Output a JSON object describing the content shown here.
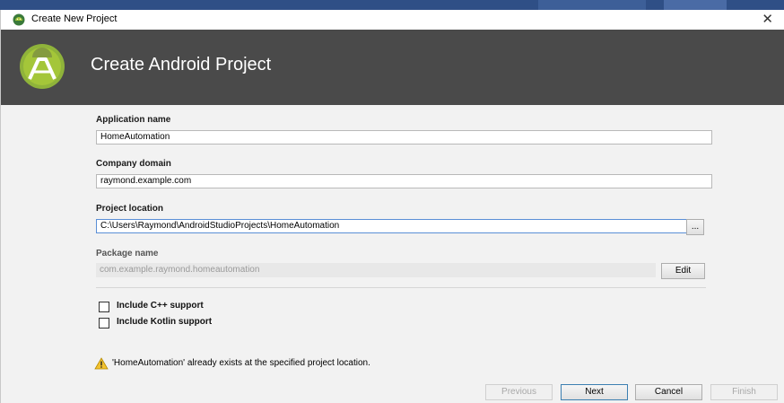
{
  "window": {
    "title": "Create New Project",
    "close_glyph": "✕"
  },
  "banner": {
    "title": "Create Android Project",
    "logo_icon": "android-studio-logo-icon"
  },
  "form": {
    "app_name_label": "Application name",
    "app_name_value": "HomeAutomation",
    "company_domain_label": "Company domain",
    "company_domain_value": "raymond.example.com",
    "project_location_label": "Project location",
    "project_location_value": "C:\\Users\\Raymond\\AndroidStudioProjects\\HomeAutomation",
    "browse_label": "...",
    "package_name_label": "Package name",
    "package_name_value": "com.example.raymond.homeautomation",
    "edit_label": "Edit"
  },
  "options": {
    "cpp_label": "Include C++ support",
    "kotlin_label": "Include Kotlin support"
  },
  "warning": {
    "text": "'HomeAutomation' already exists at the specified project location.",
    "icon": "warning-icon"
  },
  "footer": {
    "previous_label": "Previous",
    "next_label": "Next",
    "cancel_label": "Cancel",
    "finish_label": "Finish"
  },
  "colors": {
    "banner": "#4a4a4a",
    "dialog_bg": "#f2f2f2",
    "focus_border": "#5a8fd6",
    "android_green": "#a4c639"
  }
}
